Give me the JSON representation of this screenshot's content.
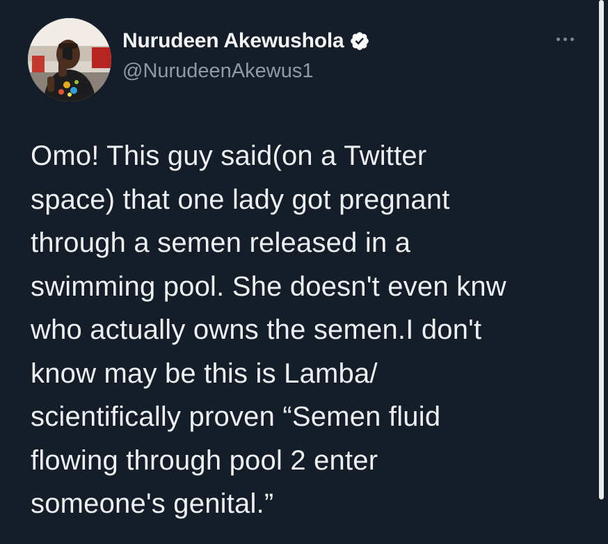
{
  "author": {
    "display_name": "Nurudeen Akewushola",
    "handle": "@NurudeenAkewus1",
    "verified": true,
    "avatar_icon": "profile-photo"
  },
  "tweet": {
    "text": "Omo! This guy said(on a Twitter\nspace)  that one lady got pregnant\nthrough a semen released in a\nswimming pool. She doesn't even knw\nwho actually owns the semen.I don't\nknow may be this is Lamba/\nscientifically proven “Semen fluid\nflowing through pool 2 enter\nsomeone's genital.”"
  },
  "icons": {
    "more": "more-horizontal-icon",
    "verified": "verified-badge-icon"
  },
  "colors": {
    "background": "#151d28",
    "text": "#eef1f4",
    "secondary_text": "#8f9aa6",
    "verified_badge": "#ffffff"
  }
}
